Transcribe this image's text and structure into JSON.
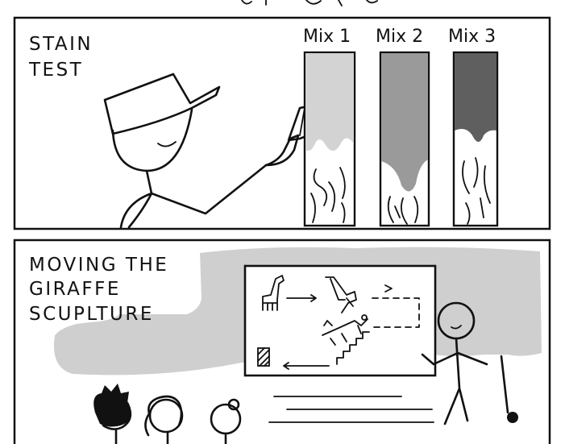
{
  "panel_top": {
    "caption_line1": "STAIN",
    "caption_line2": "TEST",
    "mix_labels": [
      "Mix 1",
      "Mix 2",
      "Mix 3"
    ]
  },
  "panel_bottom": {
    "caption_lines": [
      "MOVING THE",
      "GIRAFFE",
      "SCUPLTURE"
    ]
  },
  "colors": {
    "ink": "#111111",
    "gray_light": "#d3d3d3",
    "gray_mid": "#9a9a9a",
    "gray_dark": "#5f5f5f",
    "background_blob": "#cfcfcf"
  }
}
